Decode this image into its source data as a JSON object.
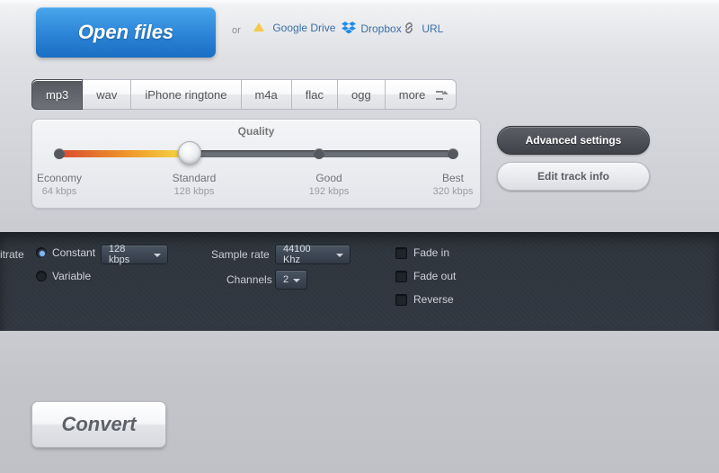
{
  "open": {
    "button": "Open files",
    "or": "or",
    "gdrive": "Google Drive",
    "dropbox": "Dropbox",
    "url": "URL"
  },
  "formats": {
    "items": [
      "mp3",
      "wav",
      "iPhone ringtone",
      "m4a",
      "flac",
      "ogg",
      "more"
    ],
    "active_index": 0
  },
  "quality": {
    "title": "Quality",
    "stops": [
      {
        "name": "Economy",
        "rate": "64 kbps"
      },
      {
        "name": "Standard",
        "rate": "128 kbps"
      },
      {
        "name": "Good",
        "rate": "192 kbps"
      },
      {
        "name": "Best",
        "rate": "320 kbps"
      }
    ],
    "selected_index": 1
  },
  "side": {
    "advanced": "Advanced settings",
    "edit": "Edit track info"
  },
  "advanced": {
    "bitrate_label": "itrate",
    "bitrate_mode": {
      "constant": "Constant",
      "variable": "Variable",
      "selected": "constant"
    },
    "bitrate_value": "128 kbps",
    "sample_label": "Sample rate",
    "sample_value": "44100 Khz",
    "channels_label": "Channels",
    "channels_value": "2",
    "fade_in": "Fade in",
    "fade_out": "Fade out",
    "reverse": "Reverse",
    "checks": {
      "fade_in": false,
      "fade_out": false,
      "reverse": false
    }
  },
  "convert": "Convert"
}
